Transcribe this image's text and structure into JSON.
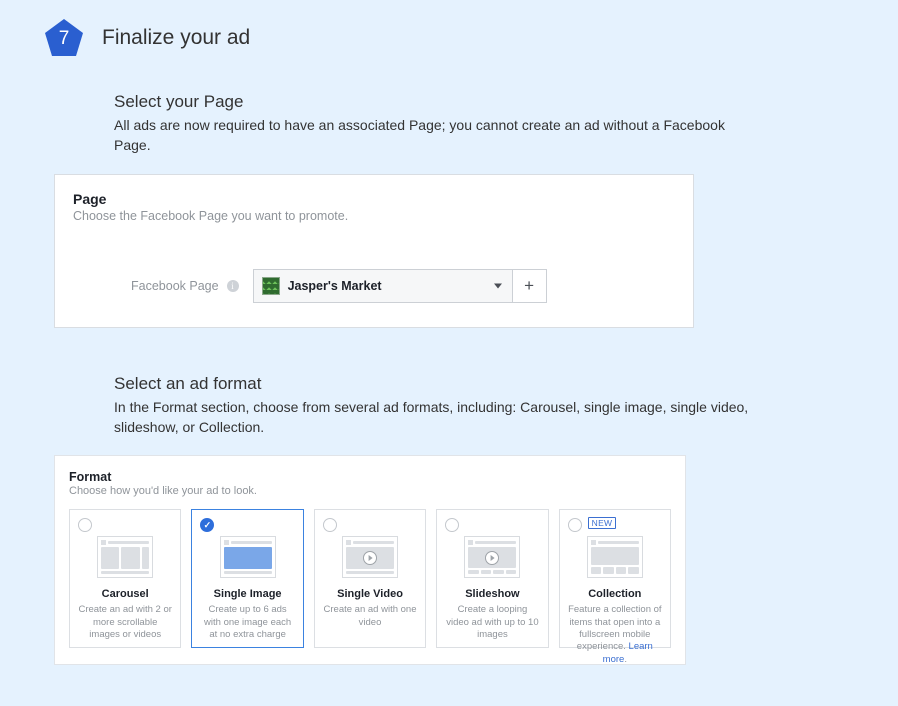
{
  "step_number": "7",
  "step_title": "Finalize your ad",
  "sections": {
    "page": {
      "heading": "Select your Page",
      "desc": "All ads are now required to have an associated Page; you cannot create an ad without a Facebook Page."
    },
    "format": {
      "heading": "Select an ad format",
      "desc": "In the Format section, choose from several ad formats, including: Carousel, single image, single video, slideshow, or Collection."
    }
  },
  "page_panel": {
    "title": "Page",
    "subtitle": "Choose the Facebook Page you want to promote.",
    "label": "Facebook Page",
    "selected_page": "Jasper's Market",
    "add_label": "+"
  },
  "format_panel": {
    "title": "Format",
    "subtitle": "Choose how you'd like your ad to look.",
    "new_badge": "NEW",
    "learn_more": "Learn more",
    "options": [
      {
        "id": "carousel",
        "title": "Carousel",
        "desc": "Create an ad with 2 or more scrollable images or videos",
        "selected": false,
        "new": false
      },
      {
        "id": "single-image",
        "title": "Single Image",
        "desc": "Create up to 6 ads with one image each at no extra charge",
        "selected": true,
        "new": false
      },
      {
        "id": "single-video",
        "title": "Single Video",
        "desc": "Create an ad with one video",
        "selected": false,
        "new": false
      },
      {
        "id": "slideshow",
        "title": "Slideshow",
        "desc": "Create a looping video ad with up to 10 images",
        "selected": false,
        "new": false
      },
      {
        "id": "collection",
        "title": "Collection",
        "desc": "Feature a collection of items that open into a fullscreen mobile experience. ",
        "selected": false,
        "new": true
      }
    ]
  }
}
